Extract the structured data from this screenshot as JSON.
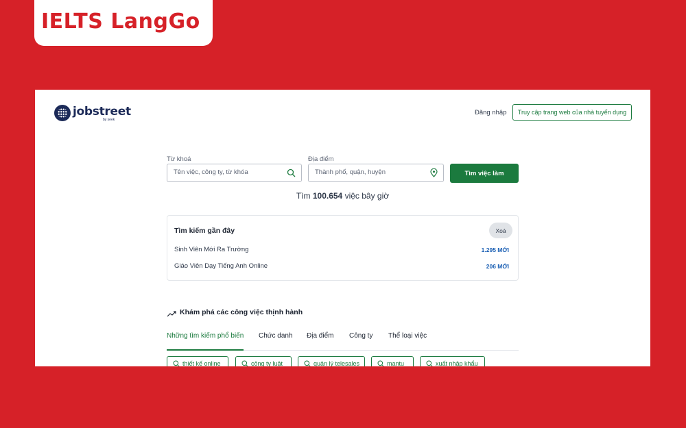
{
  "brand": {
    "name": "IELTS LangGo"
  },
  "header": {
    "logo_word": "jobstreet",
    "logo_sub": "by seek",
    "login_label": "Đăng nhập",
    "employer_button_label": "Truy cập trang web của nhà tuyển dụng"
  },
  "search": {
    "keyword_label": "Từ khoá",
    "keyword_placeholder": "Tên việc, công ty, từ khóa",
    "location_label": "Địa điểm",
    "location_placeholder": "Thành phố, quận, huyện",
    "button_label": "Tìm việc làm",
    "count_prefix": "Tìm",
    "count_value": "100.654",
    "count_suffix": "việc bây giờ"
  },
  "recent": {
    "title": "Tìm kiếm gần đây",
    "clear_label": "Xoá",
    "items": [
      {
        "label": "Sinh Viên Mới Ra Trường",
        "count": "1.295 MỚI"
      },
      {
        "label": "Giáo Viên Dạy Tiếng Anh Online",
        "count": "206 MỚI"
      }
    ]
  },
  "explore": {
    "title": "Khám phá các công việc thịnh hành",
    "tabs": [
      {
        "label": "Những tìm kiếm phổ biến",
        "active": true
      },
      {
        "label": "Chức danh",
        "active": false
      },
      {
        "label": "Địa điểm",
        "active": false
      },
      {
        "label": "Công ty",
        "active": false
      },
      {
        "label": "Thể loại việc",
        "active": false
      }
    ],
    "chips": [
      "thiết kế online",
      "công ty luật",
      "quản lý telesales",
      "mantu",
      "xuất nhập khẩu"
    ]
  },
  "colors": {
    "background": "#d62128",
    "accent_green": "#1b7a3e",
    "logo_navy": "#1c2a58",
    "link_blue": "#1a5fb4"
  },
  "icons": [
    "search-icon",
    "location-pin-icon",
    "trending-icon"
  ]
}
